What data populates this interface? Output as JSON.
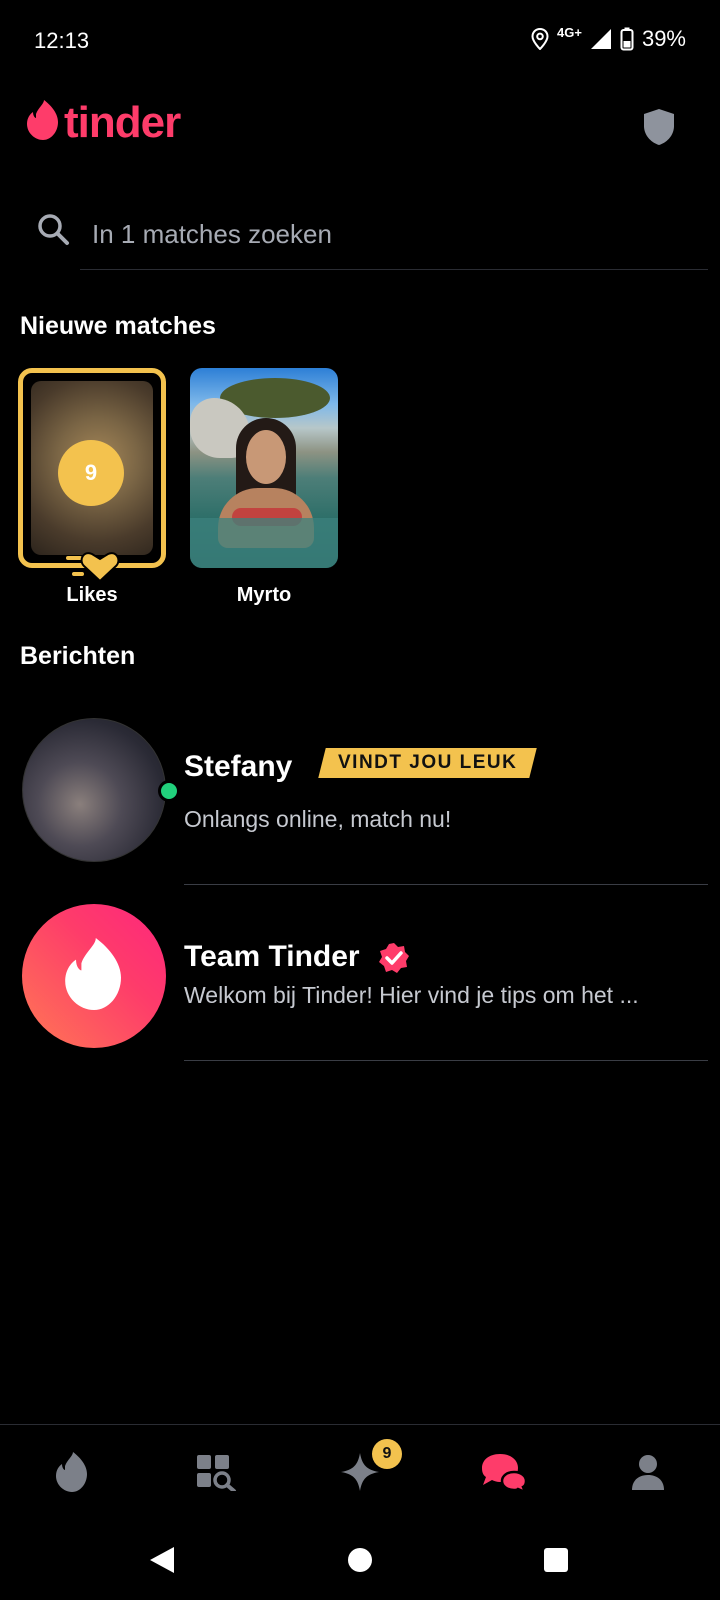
{
  "status_bar": {
    "time": "12:13",
    "network": "4G+",
    "battery": "39%"
  },
  "header": {
    "logo_text": "tinder"
  },
  "search": {
    "placeholder": "In 1 matches zoeken"
  },
  "new_matches": {
    "title": "Nieuwe matches",
    "likes": {
      "label": "Likes",
      "count": "9"
    },
    "matches": [
      {
        "name": "Myrto"
      }
    ]
  },
  "messages": {
    "title": "Berichten",
    "items": [
      {
        "name": "Stefany",
        "tag": "VINDT JOU LEUK",
        "preview": "Onlangs online, match nu!",
        "online": true
      },
      {
        "name": "Team Tinder",
        "verified": true,
        "preview": "Welkom bij Tinder! Hier vind je tips om het ..."
      }
    ]
  },
  "bottom_nav": {
    "items": [
      {
        "icon": "flame-icon"
      },
      {
        "icon": "explore-icon"
      },
      {
        "icon": "sparkle-icon",
        "badge": "9"
      },
      {
        "icon": "chat-icon",
        "active": true
      },
      {
        "icon": "profile-icon"
      }
    ]
  },
  "colors": {
    "brand": "#fe3c6a",
    "gold": "#f3c24e",
    "online": "#21d07c"
  }
}
